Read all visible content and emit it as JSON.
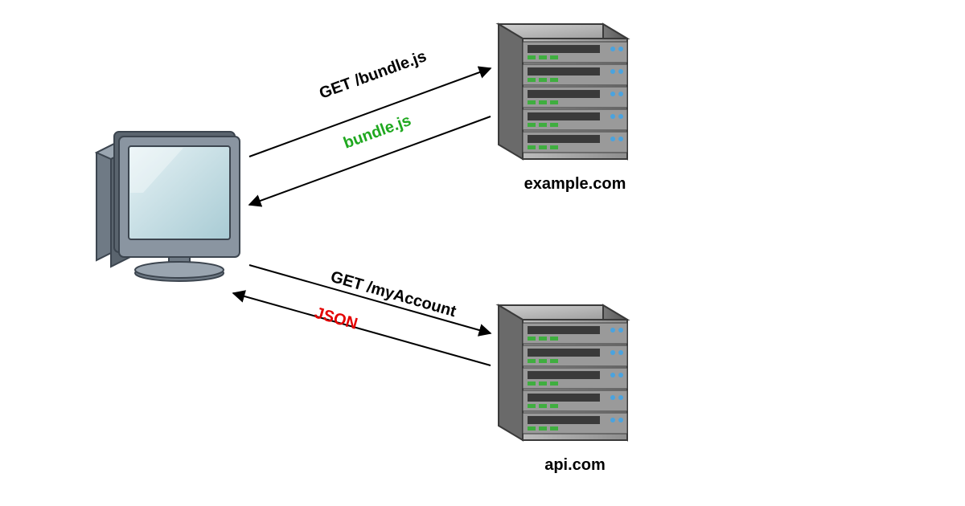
{
  "client": {
    "label": ""
  },
  "servers": {
    "top": {
      "label": "example.com"
    },
    "bottom": {
      "label": "api.com"
    }
  },
  "flows": {
    "top": {
      "request": "GET /bundle.js",
      "response": "bundle.js"
    },
    "bottom": {
      "request": "GET /myAccount",
      "response": "JSON"
    }
  },
  "colors": {
    "request": "#000000",
    "response_ok": "#1fa81f",
    "response_highlight": "#e40000",
    "server_body": "#8e8e8e",
    "server_light": "#bcbcbc",
    "server_dark": "#5a5a5a",
    "led_blue": "#4aa3df",
    "led_green": "#3fae3f",
    "monitor_frame": "#6f7a85",
    "monitor_screen": "#bcd8df"
  }
}
